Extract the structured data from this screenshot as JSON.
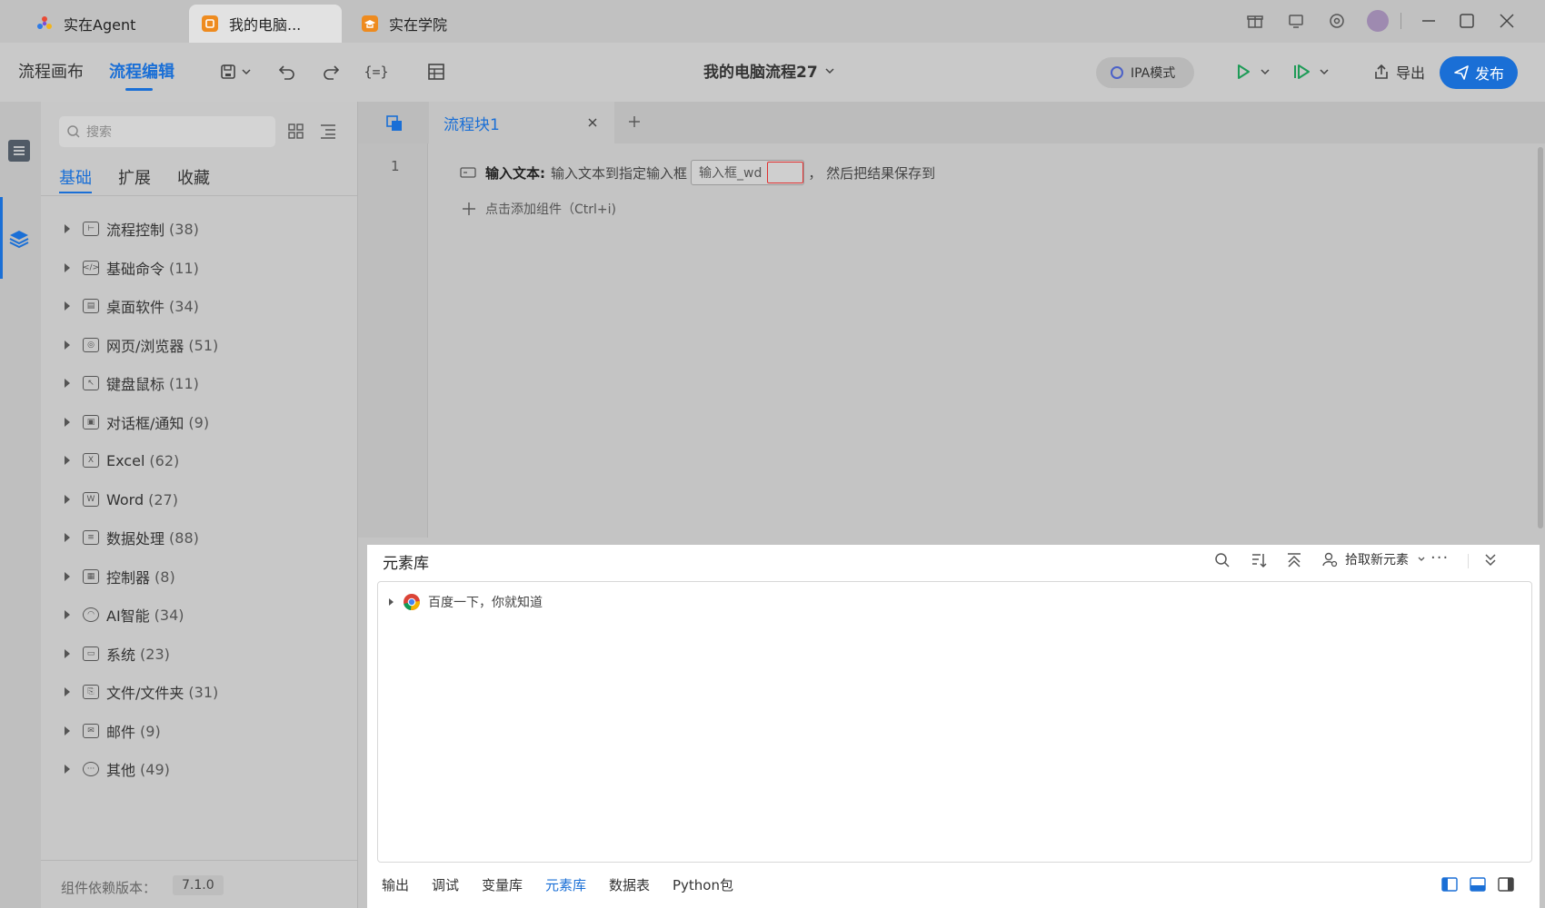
{
  "titlebar": {
    "tabs": [
      {
        "label": "实在Agent"
      },
      {
        "label": "我的电脑..."
      },
      {
        "label": "实在学院"
      }
    ]
  },
  "toolbar": {
    "view_canvas": "流程画布",
    "view_edit": "流程编辑",
    "flow_title": "我的电脑流程27",
    "ipa_mode": "IPA模式",
    "export_label": "导出",
    "publish_label": "发布"
  },
  "sidebar": {
    "search_placeholder": "搜索",
    "tabs": [
      "基础",
      "扩展",
      "收藏"
    ],
    "categories": [
      {
        "label": "流程控制",
        "count": "(38)"
      },
      {
        "label": "基础命令",
        "count": "(11)"
      },
      {
        "label": "桌面软件",
        "count": "(34)"
      },
      {
        "label": "网页/浏览器",
        "count": "(51)"
      },
      {
        "label": "键盘鼠标",
        "count": "(11)"
      },
      {
        "label": "对话框/通知",
        "count": "(9)"
      },
      {
        "label": "Excel",
        "count": "(62)"
      },
      {
        "label": "Word",
        "count": "(27)"
      },
      {
        "label": "数据处理",
        "count": "(88)"
      },
      {
        "label": "控制器",
        "count": "(8)"
      },
      {
        "label": "AI智能",
        "count": "(34)"
      },
      {
        "label": "系统",
        "count": "(23)"
      },
      {
        "label": "文件/文件夹",
        "count": "(31)"
      },
      {
        "label": "邮件",
        "count": "(9)"
      },
      {
        "label": "其他",
        "count": "(49)"
      }
    ],
    "version_label": "组件依赖版本：",
    "version_value": "7.1.0"
  },
  "editor": {
    "tab_label": "流程块1",
    "line_number": "1",
    "step_title": "输入文本:",
    "step_desc": "输入文本到指定输入框",
    "step_element": "输入框_wd",
    "step_suffix": "，  然后把结果保存到",
    "add_hint": "点击添加组件（Ctrl+i)"
  },
  "panel": {
    "title": "元素库",
    "pick_label": "拾取新元素",
    "tree_item": "百度一下，你就知道",
    "bottom_tabs": [
      "输出",
      "调试",
      "变量库",
      "元素库",
      "数据表",
      "Python包"
    ]
  },
  "colors": {
    "accent": "#1a6fd6",
    "play_green": "#1e9b57",
    "required_red": "#e03030"
  }
}
